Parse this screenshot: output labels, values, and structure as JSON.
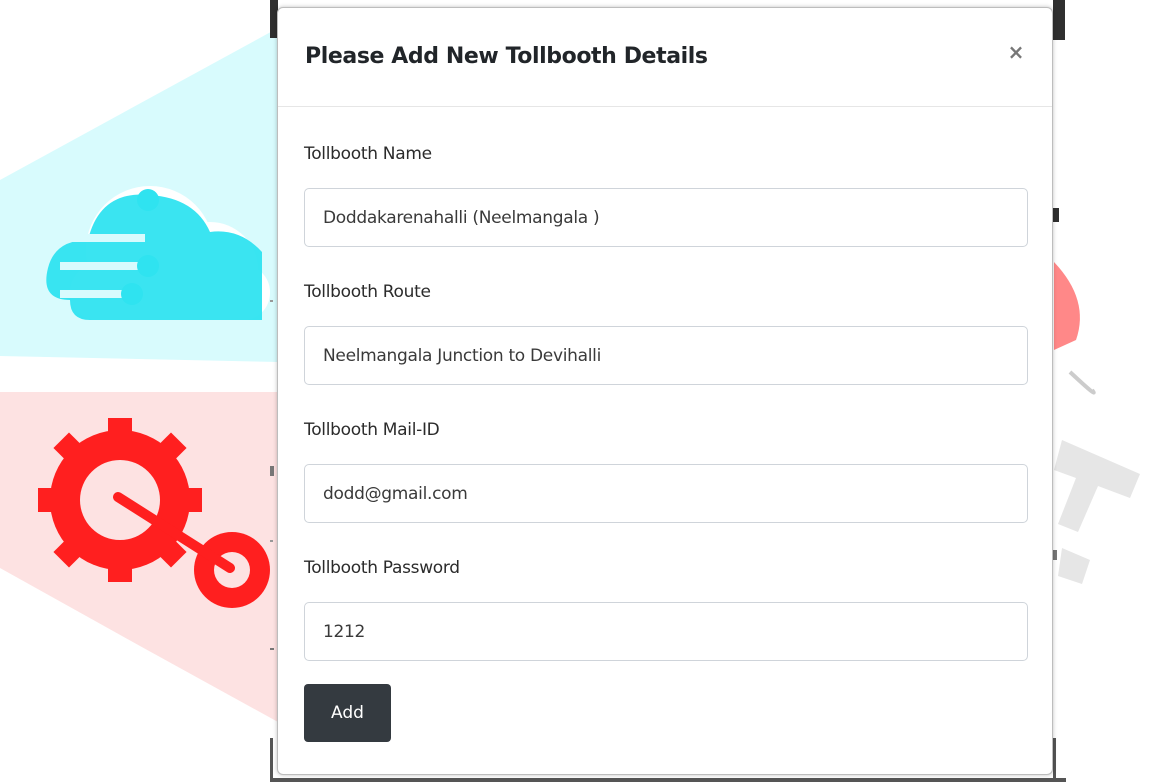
{
  "modal": {
    "title": "Please Add New Tollbooth Details",
    "close_label": "×",
    "submit_label": "Add"
  },
  "fields": {
    "name": {
      "label": "Tollbooth Name",
      "value": "Doddakarenahalli (Neelmangala )"
    },
    "route": {
      "label": "Tollbooth Route",
      "value": "Neelmangala Junction to Devihalli"
    },
    "mail": {
      "label": "Tollbooth Mail-ID",
      "value": "dodd@gmail.com"
    },
    "password": {
      "label": "Tollbooth Password",
      "value": "1212"
    }
  },
  "colors": {
    "button_dark": "#343a40",
    "watermark_cyan": "#d6fbfd",
    "watermark_pink": "#fde0e0",
    "watermark_red": "#ff1c1c"
  }
}
